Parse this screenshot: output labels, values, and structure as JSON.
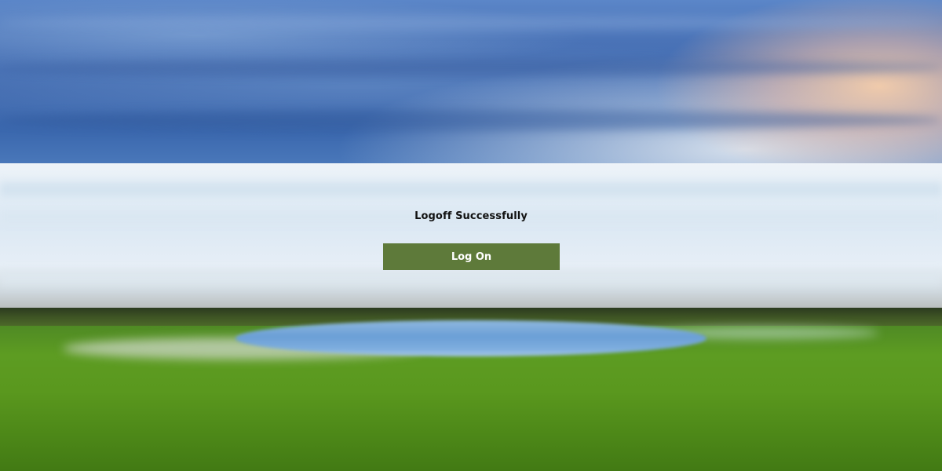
{
  "logoff": {
    "message": "Logoff Successfully",
    "button_label": "Log On"
  },
  "colors": {
    "button_bg": "#5e7a3a",
    "button_text": "#ffffff",
    "message_text": "#111111"
  }
}
